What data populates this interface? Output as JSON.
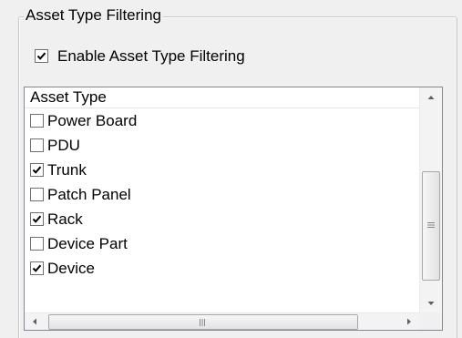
{
  "group": {
    "title": "Asset Type  Filtering"
  },
  "enable": {
    "label": "Enable  Asset Type  Filtering",
    "checked": true
  },
  "list": {
    "column_header": "Asset Type",
    "items": [
      {
        "label": "Power Board",
        "checked": false
      },
      {
        "label": "PDU",
        "checked": false
      },
      {
        "label": "Trunk",
        "checked": true
      },
      {
        "label": "Patch Panel",
        "checked": false
      },
      {
        "label": "Rack",
        "checked": true
      },
      {
        "label": "Device Part",
        "checked": false
      },
      {
        "label": "Device",
        "checked": true
      }
    ]
  },
  "scrollbars": {
    "vertical_icons": [
      "scroll-up-arrow-icon",
      "scroll-down-arrow-icon",
      "thumb-grip-icon"
    ],
    "horizontal_icons": [
      "scroll-left-arrow-icon",
      "scroll-right-arrow-icon",
      "thumb-grip-icon"
    ]
  }
}
